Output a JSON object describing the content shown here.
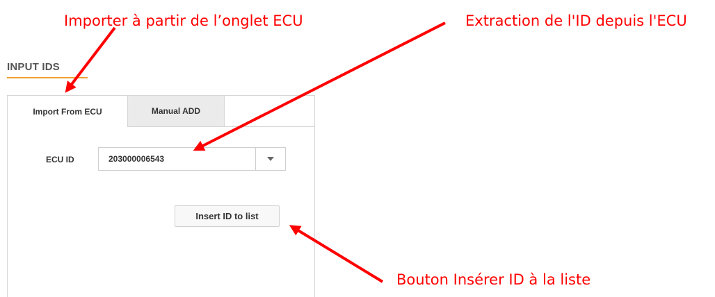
{
  "annotations": {
    "import_tab_note": "Importer à partir de l’onglet ECU",
    "extraction_note": "Extraction de l'ID depuis l'ECU",
    "insert_button_note": "Bouton Insérer ID à la liste",
    "color": "#ff0000"
  },
  "section": {
    "title": "INPUT IDS",
    "accent_color": "#f0a030"
  },
  "tabs": [
    {
      "label": "Import From ECU",
      "active": true
    },
    {
      "label": "Manual ADD",
      "active": false
    }
  ],
  "form": {
    "ecu_id_label": "ECU ID",
    "ecu_id_value": "203000006543",
    "dropdown_icon": "caret-down-icon",
    "insert_button_label": "Insert ID to list"
  }
}
